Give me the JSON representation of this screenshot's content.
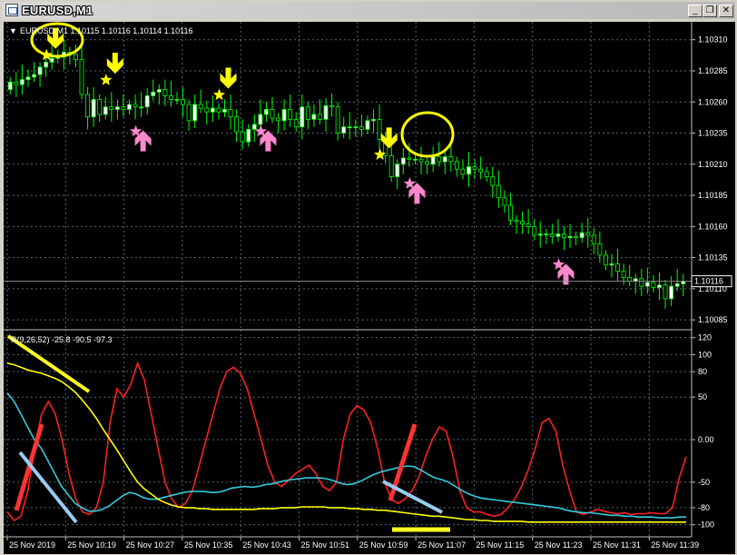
{
  "window": {
    "title": "EURUSD,M1",
    "minimize_glyph": "_",
    "restore_glyph": "❐",
    "close_glyph": "✕"
  },
  "chart_header": {
    "dropdown_glyph": "▼",
    "info": "EURUSD,M1  1.10115 1.10116 1.10114 1.10116"
  },
  "indicator_header": {
    "label": "R(9,26,52) -25.8 -90.5 -97.3"
  },
  "colors": {
    "background": "#000000",
    "grid": "#556677",
    "bull_candle": "#ffffff",
    "bear_candle": "#000000",
    "wick": "#00ff00",
    "sell_arrow": "#ffff00",
    "buy_arrow": "#ff88cc",
    "line_fast": "#ff2020",
    "line_mid": "#33ccdd",
    "line_slow": "#ffff00",
    "annotation_red": "#ff3333",
    "annotation_blue": "#99ccee",
    "annotation_yellow": "#ffff22"
  },
  "icons": {
    "sell_signal": "arrow-down-icon",
    "buy_signal": "arrow-up-icon",
    "signal_marker": "star-icon"
  },
  "chart_data": [
    {
      "type": "candlestick",
      "symbol": "EURUSD",
      "timeframe": "M1",
      "ylim": [
        1.1008,
        1.1032
      ],
      "y_ticks": [
        "1.10310",
        "1.10285",
        "1.10260",
        "1.10235",
        "1.10210",
        "1.10185",
        "1.10160",
        "1.10135",
        "1.10110",
        "1.10085"
      ],
      "current_price_label": "1.10116",
      "current_price": 1.10116,
      "x_ticks": [
        "25 Nov 2019",
        "25 Nov 10:19",
        "25 Nov 10:27",
        "25 Nov 10:35",
        "25 Nov 10:43",
        "25 Nov 10:51",
        "25 Nov 10:59",
        "25 Nov 11:07",
        "25 Nov 11:15",
        "25 Nov 11:23",
        "25 Nov 11:31",
        "25 Nov 11:39"
      ],
      "close": [
        1.10276,
        1.10274,
        1.10278,
        1.1028,
        1.10282,
        1.10288,
        1.10292,
        1.10295,
        1.10296,
        1.103,
        1.10298,
        1.10294,
        1.10266,
        1.10248,
        1.10262,
        1.1025,
        1.10256,
        1.10254,
        1.10256,
        1.10254,
        1.10258,
        1.10256,
        1.10256,
        1.10265,
        1.10268,
        1.1027,
        1.10265,
        1.10262,
        1.10262,
        1.10258,
        1.10245,
        1.10258,
        1.10255,
        1.10252,
        1.10255,
        1.10252,
        1.10254,
        1.10248,
        1.10236,
        1.10228,
        1.10238,
        1.10242,
        1.1025,
        1.10254,
        1.10247,
        1.10245,
        1.10254,
        1.10246,
        1.1024,
        1.10256,
        1.10246,
        1.1025,
        1.10246,
        1.10257,
        1.10256,
        1.10235,
        1.1024,
        1.1024,
        1.1024,
        1.10238,
        1.10245,
        1.10246,
        1.1023,
        1.10217,
        1.102,
        1.1021,
        1.10215,
        1.10214,
        1.10214,
        1.10212,
        1.1021,
        1.10216,
        1.10212,
        1.10216,
        1.10212,
        1.10206,
        1.10202,
        1.10208,
        1.10206,
        1.10204,
        1.102,
        1.10193,
        1.10183,
        1.10177,
        1.10165,
        1.10164,
        1.10162,
        1.1016,
        1.10153,
        1.10154,
        1.10154,
        1.10152,
        1.10154,
        1.10151,
        1.10152,
        1.10151,
        1.10155,
        1.10153,
        1.10146,
        1.10137,
        1.10129,
        1.1013,
        1.10124,
        1.10119,
        1.10116,
        1.10118,
        1.10112,
        1.10115,
        1.10111,
        1.10113,
        1.10102,
        1.10112,
        1.10114,
        1.10116
      ],
      "open": [
        1.1027,
        1.10276,
        1.10274,
        1.10278,
        1.1028,
        1.10282,
        1.10288,
        1.10292,
        1.10295,
        1.10296,
        1.103,
        1.10298,
        1.10294,
        1.10266,
        1.10248,
        1.10262,
        1.1025,
        1.10256,
        1.10254,
        1.10256,
        1.10254,
        1.10258,
        1.10256,
        1.10256,
        1.10265,
        1.10268,
        1.1027,
        1.10265,
        1.10262,
        1.10262,
        1.10258,
        1.10245,
        1.10258,
        1.10255,
        1.10252,
        1.10255,
        1.10252,
        1.10254,
        1.10248,
        1.10236,
        1.10228,
        1.10238,
        1.10242,
        1.1025,
        1.10254,
        1.10247,
        1.10245,
        1.10254,
        1.10246,
        1.1024,
        1.10256,
        1.10246,
        1.1025,
        1.10246,
        1.10257,
        1.10256,
        1.10235,
        1.1024,
        1.1024,
        1.1024,
        1.10238,
        1.10245,
        1.10246,
        1.1023,
        1.10217,
        1.102,
        1.1021,
        1.10215,
        1.10214,
        1.10214,
        1.10212,
        1.1021,
        1.10216,
        1.10212,
        1.10216,
        1.10212,
        1.10206,
        1.10202,
        1.10208,
        1.10206,
        1.10204,
        1.102,
        1.10193,
        1.10183,
        1.10177,
        1.10165,
        1.10164,
        1.10162,
        1.1016,
        1.10153,
        1.10154,
        1.10154,
        1.10152,
        1.10154,
        1.10151,
        1.10152,
        1.10151,
        1.10155,
        1.10153,
        1.10146,
        1.10137,
        1.10129,
        1.1013,
        1.10124,
        1.10119,
        1.10116,
        1.10118,
        1.10112,
        1.10115,
        1.10111,
        1.10113,
        1.10102,
        1.10112,
        1.10114
      ],
      "sell_signal_indices": [
        7,
        17,
        36,
        63
      ],
      "sell_signal_prices": [
        1.10302,
        1.10282,
        1.1027,
        1.10222
      ],
      "buy_signal_indices": [
        22,
        43,
        68,
        93
      ],
      "buy_signal_prices": [
        1.10232,
        1.10232,
        1.1019,
        1.10125
      ]
    },
    {
      "type": "line",
      "name": "R(9,26,52)",
      "ylim": [
        -110,
        125
      ],
      "y_ticks": [
        "120",
        "100",
        "80",
        "50",
        "0.00",
        "-50",
        "-80",
        "-100"
      ],
      "y_tick_values": [
        120,
        100,
        80,
        50,
        0,
        -50,
        -80,
        -100
      ],
      "values_shown": [
        "-25.8",
        "-90.5",
        "-97.3"
      ],
      "series": [
        {
          "color": "#ff2020",
          "values": [
            -85,
            -95,
            -90,
            -60,
            -10,
            30,
            45,
            30,
            0,
            -40,
            -70,
            -85,
            -88,
            -80,
            -50,
            20,
            60,
            50,
            65,
            90,
            70,
            30,
            -10,
            -50,
            -70,
            -80,
            -75,
            -60,
            -30,
            0,
            30,
            60,
            80,
            85,
            78,
            60,
            30,
            0,
            -30,
            -50,
            -55,
            -48,
            -40,
            -35,
            -30,
            -40,
            -55,
            -60,
            -50,
            0,
            30,
            40,
            35,
            20,
            -10,
            -50,
            -70,
            -75,
            -70,
            -60,
            -45,
            -20,
            0,
            15,
            10,
            -20,
            -60,
            -80,
            -85,
            -85,
            -88,
            -90,
            -88,
            -80,
            -70,
            -55,
            -35,
            -10,
            20,
            25,
            10,
            -30,
            -60,
            -85,
            -88,
            -85,
            -82,
            -84,
            -86,
            -87,
            -86,
            -88,
            -87,
            -87,
            -86,
            -87,
            -87,
            -80,
            -45,
            -20
          ]
        },
        {
          "color": "#33ccdd",
          "values": [
            55,
            45,
            30,
            15,
            0,
            -10,
            -25,
            -40,
            -55,
            -65,
            -75,
            -80,
            -84,
            -84,
            -82,
            -78,
            -72,
            -66,
            -62,
            -64,
            -68,
            -70,
            -70,
            -68,
            -66,
            -64,
            -62,
            -61,
            -61,
            -61,
            -62,
            -62,
            -60,
            -57,
            -56,
            -55,
            -56,
            -55,
            -53,
            -52,
            -50,
            -48,
            -47,
            -46,
            -45,
            -45,
            -45,
            -46,
            -48,
            -51,
            -53,
            -52,
            -49,
            -45,
            -41,
            -38,
            -36,
            -34,
            -32,
            -31,
            -32,
            -36,
            -41,
            -45,
            -47,
            -50,
            -55,
            -60,
            -64,
            -67,
            -69,
            -70,
            -71,
            -72,
            -73,
            -74,
            -75,
            -76,
            -77,
            -78,
            -79,
            -80,
            -82,
            -84,
            -85,
            -86,
            -86,
            -87,
            -88,
            -89,
            -89,
            -90,
            -90,
            -91,
            -91,
            -91,
            -92,
            -92,
            -92,
            -91,
            -91
          ]
        },
        {
          "color": "#ffff00",
          "values": [
            90,
            88,
            85,
            82,
            80,
            78,
            75,
            72,
            68,
            62,
            55,
            46,
            36,
            25,
            12,
            0,
            -12,
            -25,
            -38,
            -50,
            -58,
            -64,
            -70,
            -74,
            -77,
            -79,
            -80,
            -80,
            -81,
            -81,
            -82,
            -82,
            -82,
            -82,
            -82,
            -82,
            -82,
            -81,
            -81,
            -81,
            -80,
            -80,
            -80,
            -79,
            -79,
            -79,
            -79,
            -80,
            -80,
            -80,
            -81,
            -81,
            -82,
            -82,
            -83,
            -83,
            -84,
            -85,
            -86,
            -87,
            -88,
            -89,
            -90,
            -90,
            -91,
            -92,
            -93,
            -94,
            -94,
            -95,
            -95,
            -96,
            -96,
            -96,
            -96,
            -96,
            -97,
            -97,
            -97,
            -97,
            -97,
            -97,
            -97,
            -97,
            -97,
            -97,
            -97,
            -97,
            -97,
            -97,
            -97,
            -97,
            -97,
            -97,
            -97,
            -97,
            -97,
            -97,
            -97,
            -97
          ]
        }
      ]
    }
  ]
}
